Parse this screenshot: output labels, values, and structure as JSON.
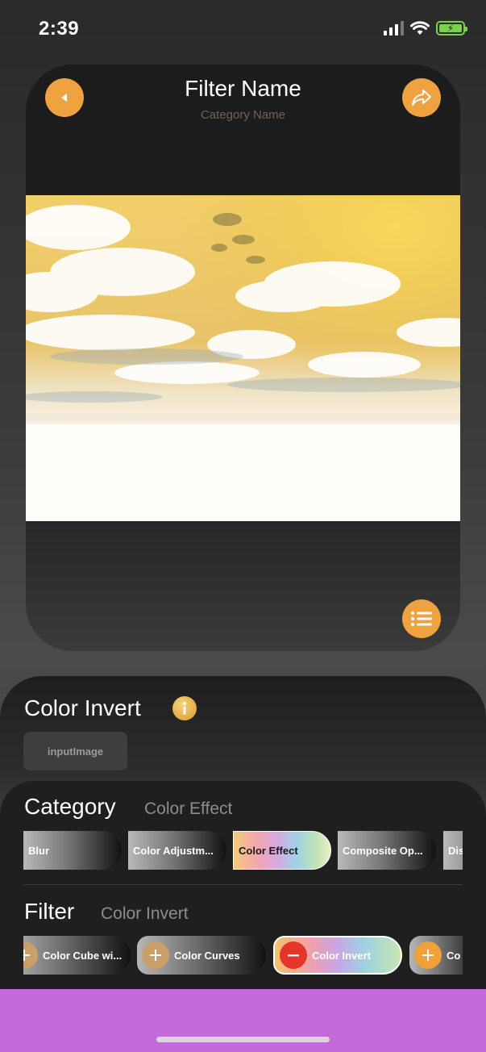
{
  "status": {
    "time": "2:39"
  },
  "preview": {
    "filter_name": "Filter Name",
    "category_name": "Category Name",
    "icons": {
      "back": "back-arrow-icon",
      "share": "share-icon",
      "menu": "list-icon"
    }
  },
  "info": {
    "title": "Color Invert",
    "icon": "info-icon",
    "input_chip": "inputImage"
  },
  "category": {
    "label": "Category",
    "value": "Color Effect",
    "chips": [
      "Blur",
      "Color Adjustm...",
      "Color Effect",
      "Composite Op...",
      "Dis"
    ],
    "selected": "Color Effect"
  },
  "filter": {
    "label": "Filter",
    "value": "Color Invert",
    "chips": [
      "Color Cube wi...",
      "Color Curves",
      "Color Invert",
      "Co"
    ],
    "selected": "Color Invert"
  },
  "colors": {
    "accent": "#eea240",
    "home_bar": "#c26bd9"
  }
}
